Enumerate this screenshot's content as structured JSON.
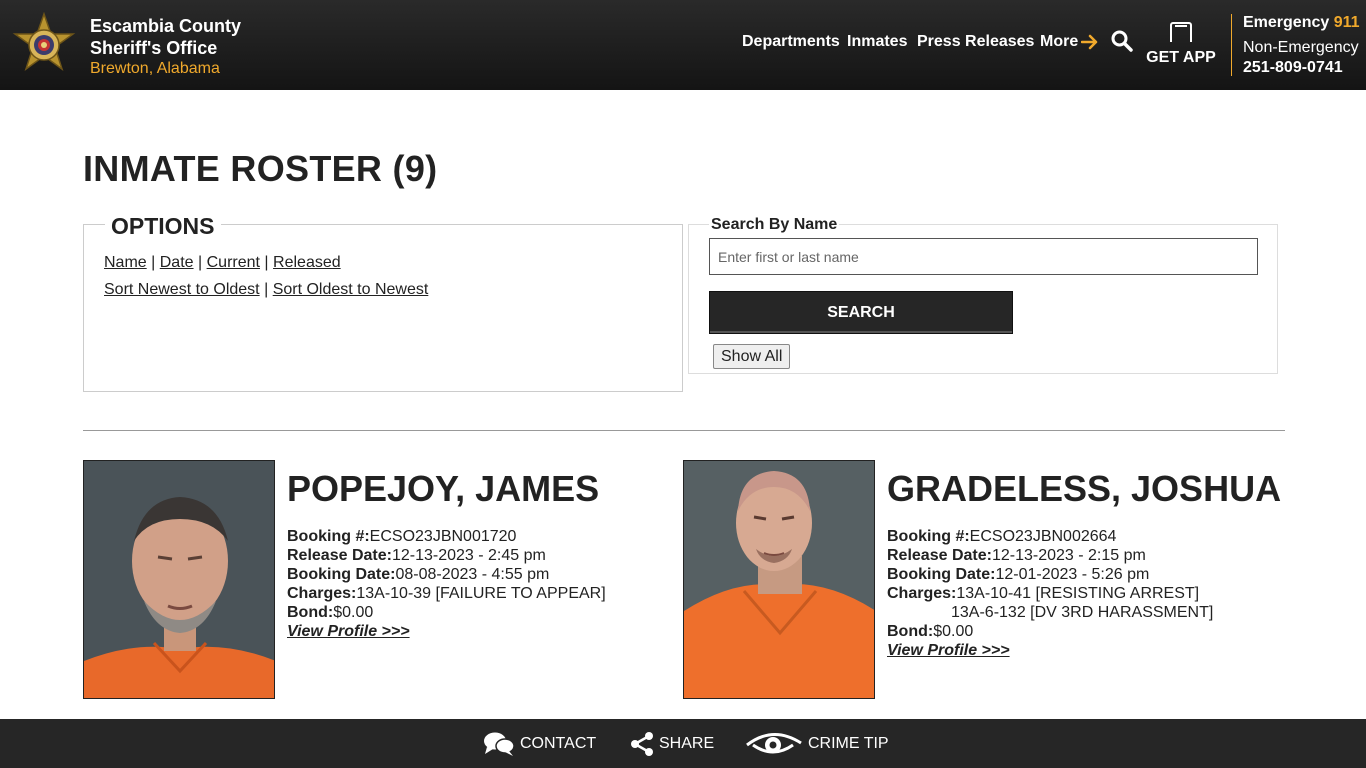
{
  "header": {
    "agency_line1": "Escambia County",
    "agency_line2": "Sheriff's Office",
    "location": "Brewton, Alabama",
    "nav": {
      "departments": "Departments",
      "inmates": "Inmates",
      "press_releases": "Press Releases",
      "more": "More"
    },
    "get_app": "GET APP",
    "emergency_label": "Emergency",
    "emergency_number": "911",
    "non_emergency_label": "Non-Emergency",
    "non_emergency_number": "251-809-0741",
    "accent_color": "#f0a92c"
  },
  "main": {
    "title": "INMATE ROSTER (9)",
    "options": {
      "legend": "OPTIONS",
      "name": "Name",
      "date": "Date",
      "current": "Current",
      "released": "Released",
      "sort_newest": "Sort Newest to Oldest",
      "sort_oldest": "Sort Oldest to Newest",
      "sep": "|"
    },
    "search": {
      "label": "Search By Name",
      "placeholder": "Enter first or last name",
      "value": "",
      "button": "SEARCH",
      "show_all": "Show All"
    },
    "inmates": [
      {
        "name": "POPEJOY, JAMES",
        "booking_label": "Booking #:",
        "booking_no": "ECSO23JBN001720",
        "release_label": "Release Date:",
        "release_date": "12-13-2023 - 2:45 pm",
        "booking_date_label": "Booking Date:",
        "booking_date": "08-08-2023 - 4:55 pm",
        "charges_label": "Charges:",
        "charges": [
          "13A-10-39 [FAILURE TO APPEAR]"
        ],
        "bond_label": "Bond:",
        "bond": "$0.00",
        "profile_link": "View Profile >>>"
      },
      {
        "name": "GRADELESS, JOSHUA",
        "booking_label": "Booking #:",
        "booking_no": "ECSO23JBN002664",
        "release_label": "Release Date:",
        "release_date": "12-13-2023 - 2:15 pm",
        "booking_date_label": "Booking Date:",
        "booking_date": "12-01-2023 - 5:26 pm",
        "charges_label": "Charges:",
        "charges": [
          "13A-10-41 [RESISTING ARREST]",
          "13A-6-132 [DV 3RD HARASSMENT]"
        ],
        "bond_label": "Bond:",
        "bond": "$0.00",
        "profile_link": "View Profile >>>"
      }
    ]
  },
  "footer": {
    "contact": "CONTACT",
    "share": "SHARE",
    "crime_tip": "CRIME TIP"
  },
  "icons": {
    "badge": "sheriff-star-badge-icon",
    "search": "search-icon",
    "phone": "phone-icon",
    "more_arrow": "arrow-right-icon",
    "contact": "chat-bubbles-icon",
    "share": "share-icon",
    "crime_tip": "eye-icon"
  }
}
